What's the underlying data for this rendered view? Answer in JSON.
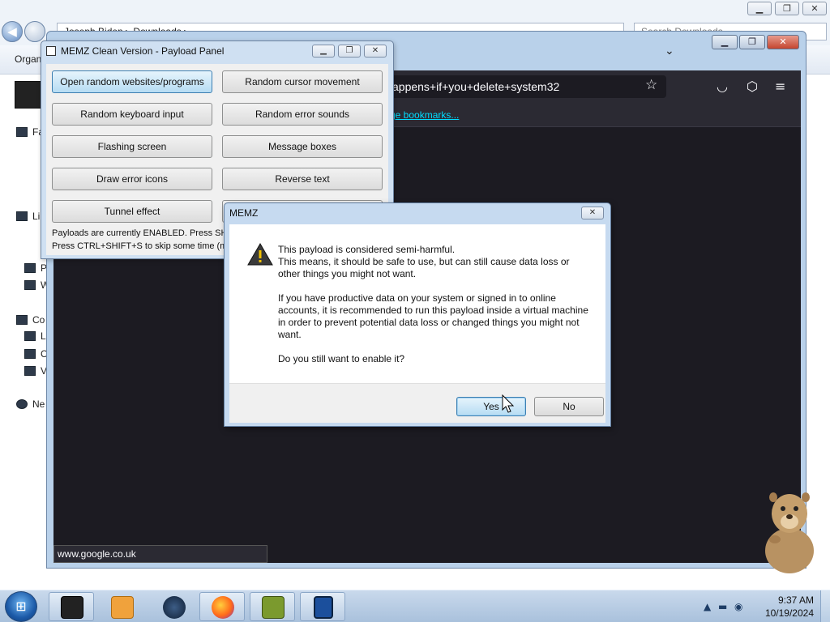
{
  "explorer": {
    "address": "Joseph Biden ▸ Downloads ▸",
    "search_placeholder": "Search Downloads",
    "toolbar_label": "Organize",
    "sidebar": [
      "Fa",
      "Li",
      "P",
      "W",
      "Co",
      "L",
      "C",
      "V",
      "Ne"
    ]
  },
  "firefox": {
    "url": "appens+if+you+delete+system32",
    "bookmarks_link": "ge bookmarks...",
    "status_url": "www.google.co.uk"
  },
  "memz_panel": {
    "title": "MEMZ Clean Version - Payload Panel",
    "buttons": [
      "Open random websites/programs",
      "Random cursor movement",
      "Random keyboard input",
      "Random error sounds",
      "Flashing screen",
      "Message boxes",
      "Draw error icons",
      "Reverse text",
      "Tunnel effect"
    ],
    "status_line_1": "Payloads are currently ENABLED. Press SHI",
    "status_line_2": "Press CTRL+SHIFT+S to skip some time (ma"
  },
  "dialog": {
    "title": "MEMZ",
    "paragraph_1_line_1": "This payload is considered semi-harmful.",
    "paragraph_1_line_2": "This means, it should be safe to use, but can still cause data loss or other things you might not want.",
    "paragraph_2": "If you have productive data on your system or signed in to online accounts, it is recommended to run this payload inside a virtual machine in order to prevent potential data loss or changed things you might not want.",
    "question": "Do you still want to enable it?",
    "yes_label": "Yes",
    "no_label": "No"
  },
  "taskbar": {
    "apps": [
      "explorer-icon",
      "media-player-icon",
      "globe-icon",
      "firefox-icon",
      "bonzi-box-icon",
      "phone-app-icon"
    ],
    "time": "9:37 AM",
    "date": "10/19/2024"
  },
  "colors": {
    "dialog_frame": "#c6daf0",
    "firefox_dark": "#1c1b22",
    "link": "#00ddff",
    "active_button": "#b6dcf3"
  }
}
